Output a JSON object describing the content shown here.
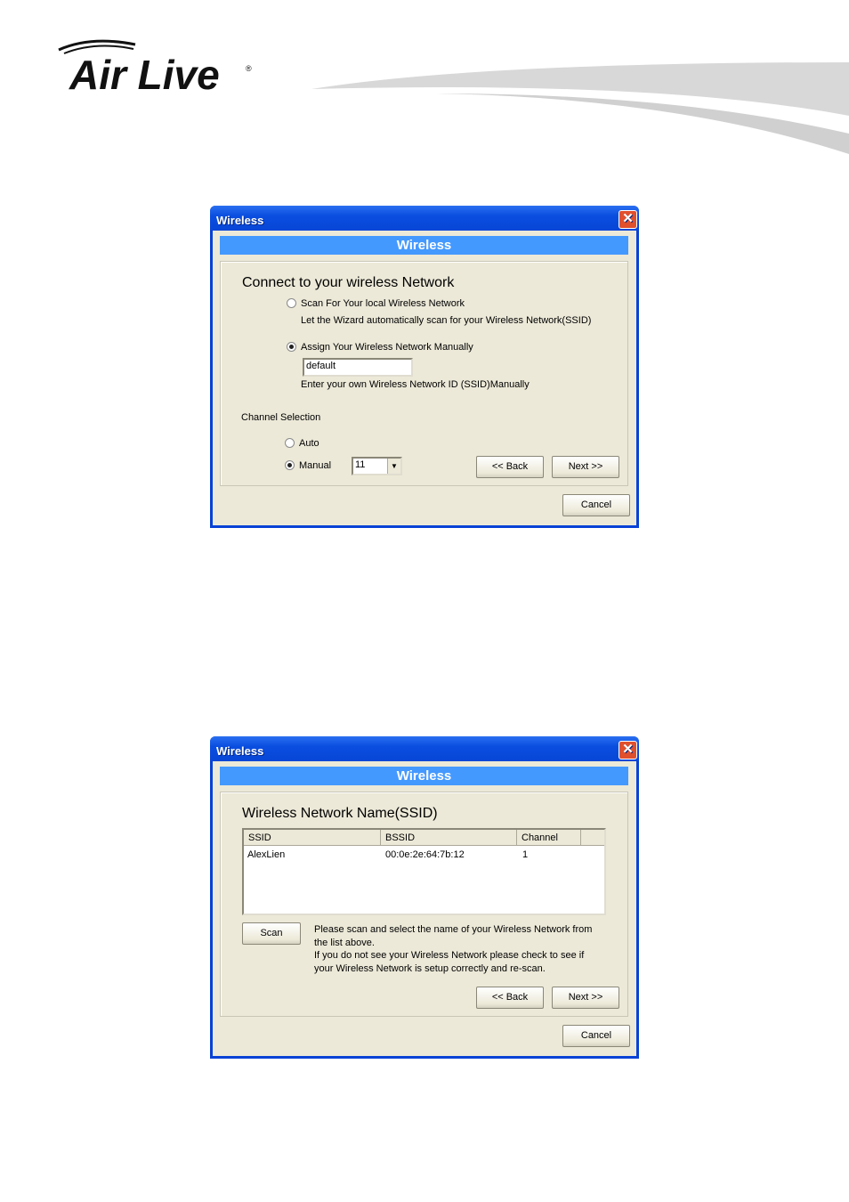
{
  "logo": {
    "text": "Air Live",
    "registered": "®"
  },
  "dialog1": {
    "title": "Wireless",
    "banner": "Wireless",
    "heading": "Connect to your wireless Network",
    "scan_option": {
      "label": "Scan For Your local Wireless Network",
      "selected": false,
      "hint": "Let the Wizard automatically scan for your Wireless Network(SSID)"
    },
    "manual_option": {
      "label": "Assign Your Wireless Network Manually",
      "selected": true,
      "ssid_value": "default",
      "hint": "Enter your own Wireless Network ID (SSID)Manually"
    },
    "channel_label": "Channel Selection",
    "channel_auto": {
      "label": "Auto",
      "selected": false
    },
    "channel_manual": {
      "label": "Manual",
      "selected": true,
      "value": "11"
    },
    "back": "<< Back",
    "next": "Next >>",
    "cancel": "Cancel"
  },
  "dialog2": {
    "title": "Wireless",
    "banner": "Wireless",
    "heading": "Wireless Network Name(SSID)",
    "columns": [
      "SSID",
      "BSSID",
      "Channel"
    ],
    "rows": [
      {
        "ssid": "AlexLien",
        "bssid": "00:0e:2e:64:7b:12",
        "channel": "1"
      }
    ],
    "scan": "Scan",
    "info": [
      "Please scan and select the name of your Wireless Network from",
      "the list above.",
      "If you do not see your Wireless Network please check to see if",
      "your Wireless Network is setup correctly and re-scan."
    ],
    "back": "<< Back",
    "next": "Next >>",
    "cancel": "Cancel"
  },
  "colors": {
    "titlebar": "#0a4ee0",
    "banner": "#4499ff",
    "dialog_bg": "#ece9d8"
  }
}
